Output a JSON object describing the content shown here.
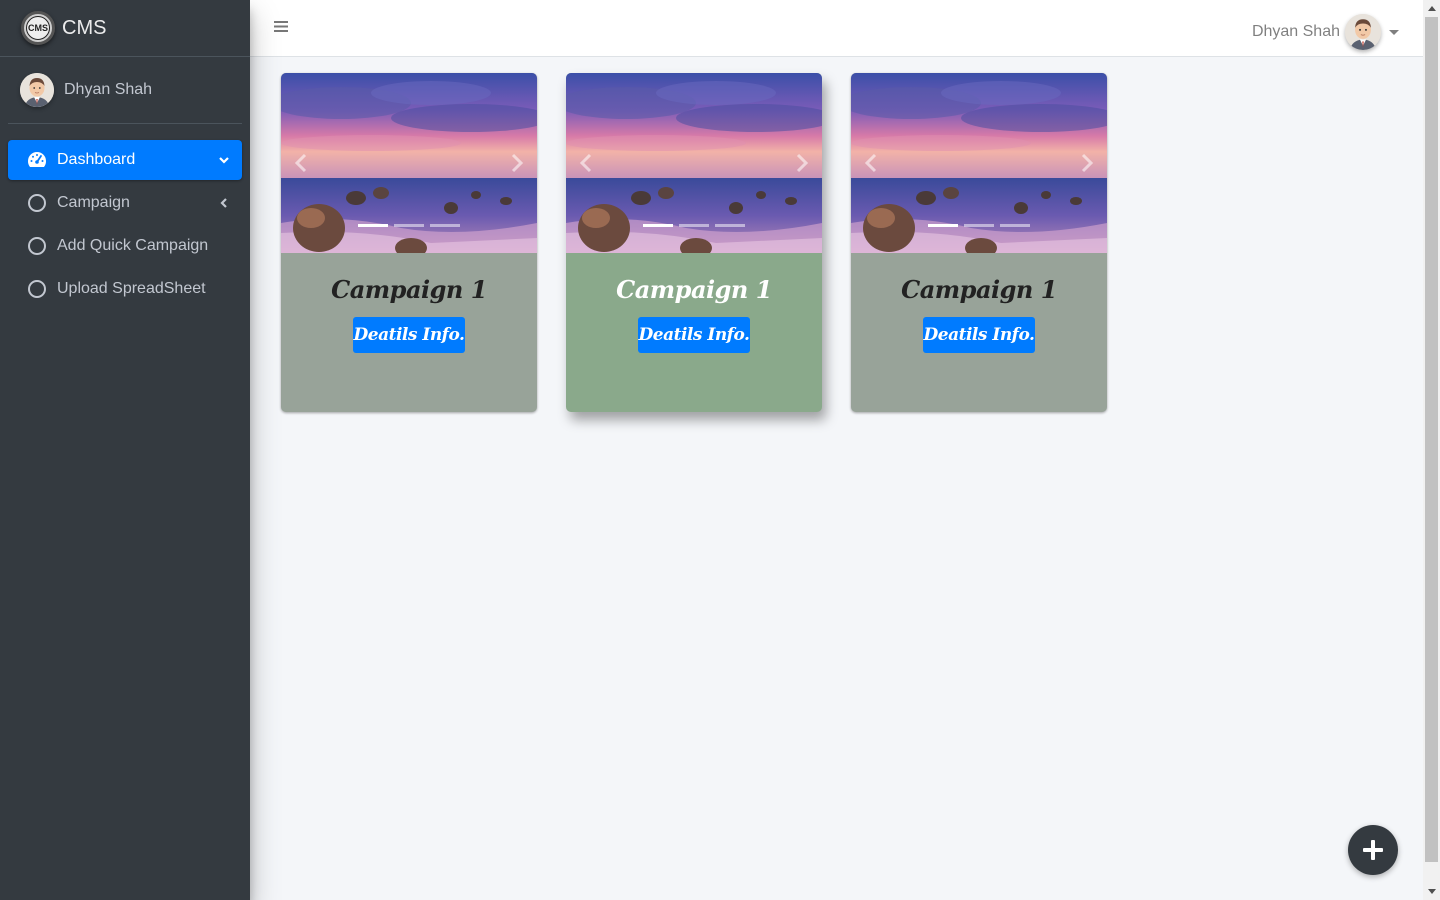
{
  "brand": {
    "logo_text": "CMS",
    "name": "CMS"
  },
  "user": {
    "name": "Dhyan Shah"
  },
  "sidebar": {
    "items": [
      {
        "label": "Dashboard",
        "icon": "tachometer-icon",
        "active": true,
        "arrow": "chevron-down-icon"
      },
      {
        "label": "Campaign",
        "icon": "circle-icon",
        "active": false,
        "arrow": "chevron-left-icon"
      },
      {
        "label": "Add Quick Campaign",
        "icon": "circle-icon",
        "active": false
      },
      {
        "label": "Upload SpreadSheet",
        "icon": "circle-icon",
        "active": false
      }
    ]
  },
  "topbar": {
    "menu_icon": "hamburger-icon",
    "user_name": "Dhyan Shah"
  },
  "cards": [
    {
      "title": "Campaign 1",
      "button_label": "Deatils Info.",
      "active_slide": 1,
      "slides": 3
    },
    {
      "title": "Campaign 1",
      "button_label": "Deatils Info.",
      "active_slide": 1,
      "slides": 3
    },
    {
      "title": "Campaign 1",
      "button_label": "Deatils Info.",
      "active_slide": 1,
      "slides": 3
    }
  ],
  "fab": {
    "icon": "plus-icon"
  },
  "colors": {
    "sidebar": "#343a40",
    "accent": "#007bff",
    "card": "#98a399",
    "card_hover": "#8aa98b",
    "background": "#f4f6f9"
  }
}
